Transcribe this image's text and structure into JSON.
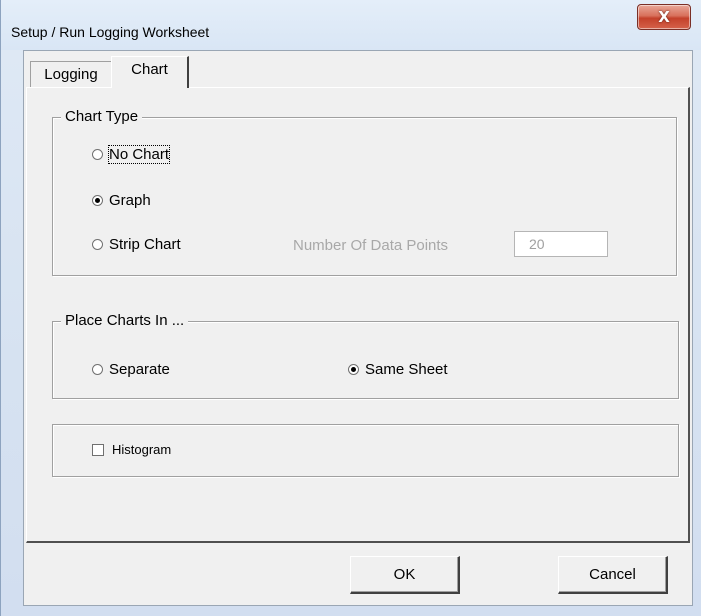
{
  "window": {
    "title": "Setup / Run Logging Worksheet",
    "close_glyph": "X"
  },
  "tabs": [
    {
      "label": "Logging",
      "selected": false
    },
    {
      "label": "Chart",
      "selected": true
    }
  ],
  "chart_type": {
    "caption": "Chart Type",
    "options": [
      {
        "label": "No Chart",
        "checked": false
      },
      {
        "label": "Graph",
        "checked": true
      },
      {
        "label": "Strip Chart",
        "checked": false
      }
    ],
    "data_points_label": "Number Of Data Points",
    "data_points_value": "20"
  },
  "place_charts": {
    "caption": "Place Charts In ...",
    "options": [
      {
        "label": "Separate",
        "checked": false
      },
      {
        "label": "Same Sheet",
        "checked": true
      }
    ]
  },
  "histogram": {
    "label": "Histogram",
    "checked": false
  },
  "buttons": {
    "ok_label": "OK",
    "cancel_label": "Cancel"
  }
}
